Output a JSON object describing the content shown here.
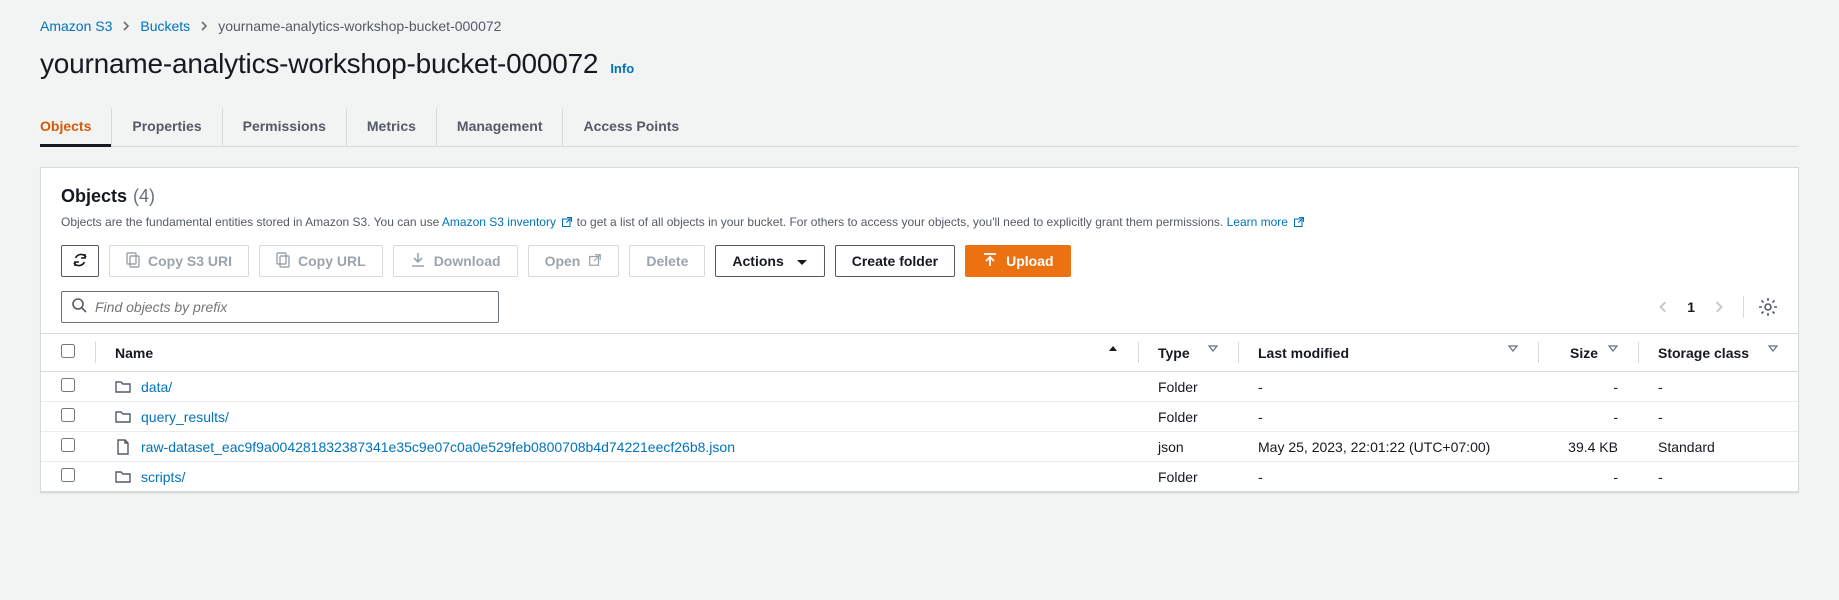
{
  "breadcrumb": {
    "root": "Amazon S3",
    "buckets": "Buckets",
    "current": "yourname-analytics-workshop-bucket-000072"
  },
  "title": "yourname-analytics-workshop-bucket-000072",
  "info_label": "Info",
  "tabs": {
    "objects": "Objects",
    "properties": "Properties",
    "permissions": "Permissions",
    "metrics": "Metrics",
    "management": "Management",
    "access_points": "Access Points"
  },
  "panel": {
    "title": "Objects",
    "count": "(4)",
    "desc_a": "Objects are the fundamental entities stored in Amazon S3. You can use ",
    "desc_link1": "Amazon S3 inventory",
    "desc_b": " to get a list of all objects in your bucket. For others to access your objects, you'll need to explicitly grant them permissions. ",
    "desc_link2": "Learn more"
  },
  "toolbar": {
    "copy_uri": "Copy S3 URI",
    "copy_url": "Copy URL",
    "download": "Download",
    "open": "Open",
    "delete": "Delete",
    "actions": "Actions",
    "create_folder": "Create folder",
    "upload": "Upload"
  },
  "search": {
    "placeholder": "Find objects by prefix"
  },
  "pagination": {
    "page": "1"
  },
  "columns": {
    "name": "Name",
    "type": "Type",
    "last_modified": "Last modified",
    "size": "Size",
    "storage_class": "Storage class"
  },
  "rows": [
    {
      "icon": "folder",
      "name": "data/",
      "type": "Folder",
      "last_modified": "-",
      "size": "-",
      "storage_class": "-"
    },
    {
      "icon": "folder",
      "name": "query_results/",
      "type": "Folder",
      "last_modified": "-",
      "size": "-",
      "storage_class": "-"
    },
    {
      "icon": "file",
      "name": "raw-dataset_eac9f9a004281832387341e35c9e07c0a0e529feb0800708b4d74221eecf26b8.json",
      "type": "json",
      "last_modified": "May 25, 2023, 22:01:22 (UTC+07:00)",
      "size": "39.4 KB",
      "storage_class": "Standard"
    },
    {
      "icon": "folder",
      "name": "scripts/",
      "type": "Folder",
      "last_modified": "-",
      "size": "-",
      "storage_class": "-"
    }
  ]
}
